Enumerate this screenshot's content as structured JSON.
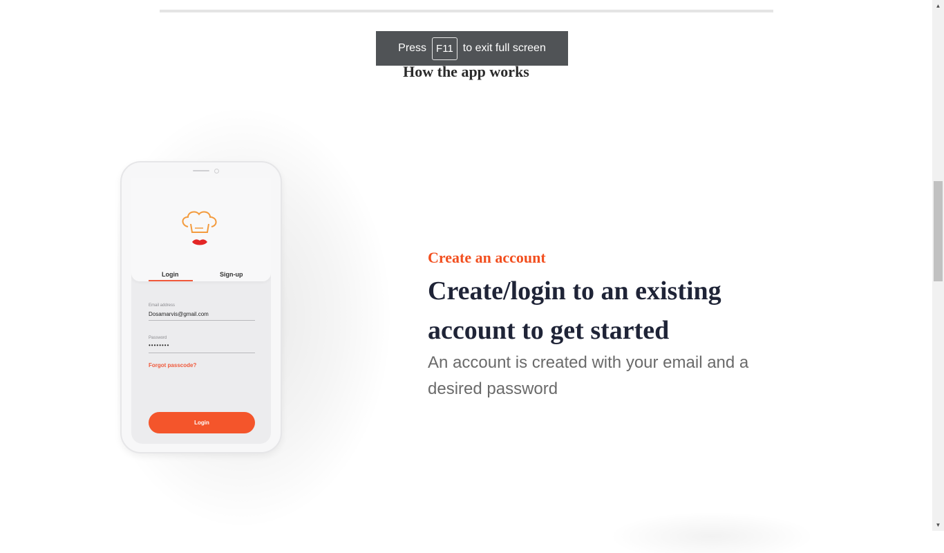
{
  "toast": {
    "prefix": "Press",
    "key": "F11",
    "suffix": "to exit full screen"
  },
  "section": {
    "heading": "How the app works"
  },
  "phone": {
    "tabs": {
      "login": "Login",
      "signup": "Sign-up"
    },
    "email": {
      "label": "Email address",
      "value": "Dosamarvis@gmail.com"
    },
    "password": {
      "label": "Password",
      "value": "••••••••"
    },
    "forgot": "Forgot passcode?",
    "login_button": "Login"
  },
  "feature": {
    "eyebrow": "Create an account",
    "headline": "Create/login to an existing account to get started",
    "body": "An account is created with your email and a desired password"
  },
  "colors": {
    "accent": "#f24f1f",
    "headline": "#1f2437",
    "body": "#6a6a6a",
    "toast_bg": "#505356"
  }
}
